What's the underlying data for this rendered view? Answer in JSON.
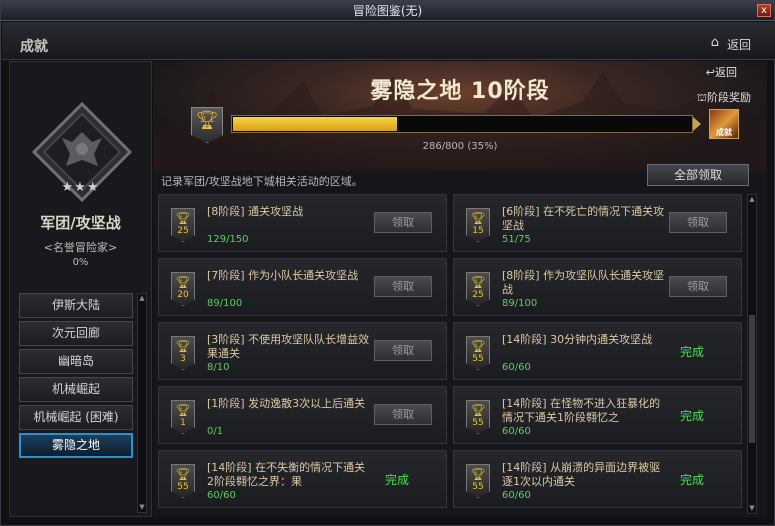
{
  "window": {
    "title": "冒险图鉴(无)",
    "close": "x"
  },
  "header": {
    "section": "成就",
    "home_icon": "home-icon",
    "back": "返回"
  },
  "left": {
    "emblem_icon": "guild-emblem-icon",
    "stars": "★★★",
    "title": "军团/攻坚战",
    "subtitle": "<名誉冒险家>",
    "percent": "0%",
    "nav": [
      {
        "label": "伊斯大陆"
      },
      {
        "label": "次元回廊"
      },
      {
        "label": "幽暗岛"
      },
      {
        "label": "机械崛起"
      },
      {
        "label": "机械崛起 (困难)"
      },
      {
        "label": "雾隐之地",
        "active": true
      }
    ]
  },
  "main": {
    "title": "雾隐之地  10阶段",
    "back": "返回",
    "stage_reward": "阶段奖励",
    "reward_icon_text": "成就",
    "progress": {
      "current": 286,
      "total": 800,
      "fraction": 0.3575,
      "text": "286/800 (35%)"
    },
    "description": "记录军团/攻坚战地下城相关活动的区域。",
    "claim_all": "全部领取",
    "cards": [
      {
        "trophy": "25",
        "title": "[8阶段] 通关攻坚战",
        "progress": "129/150",
        "action": "领取",
        "done": false
      },
      {
        "trophy": "15",
        "title": "[6阶段] 在不死亡的情况下通关攻坚战",
        "progress": "51/75",
        "action": "领取",
        "done": false
      },
      {
        "trophy": "20",
        "title": "[7阶段] 作为小队长通关攻坚战",
        "progress": "89/100",
        "action": "领取",
        "done": false
      },
      {
        "trophy": "25",
        "title": "[8阶段] 作为攻坚队队长通关攻坚战",
        "progress": "89/100",
        "action": "领取",
        "done": false
      },
      {
        "trophy": "3",
        "title": "[3阶段] 不使用攻坚队队长增益效果通关",
        "progress": "8/10",
        "action": "领取",
        "done": false
      },
      {
        "trophy": "55",
        "title": "[14阶段] 30分钟内通关攻坚战",
        "progress": "60/60",
        "action": "完成",
        "done": true
      },
      {
        "trophy": "1",
        "title": "[1阶段] 发动逸散3次以上后通关",
        "progress": "0/1",
        "action": "领取",
        "done": false
      },
      {
        "trophy": "55",
        "title": "[14阶段] 在怪物不进入狂暴化的情况下通关1阶段翱忆之",
        "progress": "60/60",
        "action": "完成",
        "done": true
      },
      {
        "trophy": "55",
        "title": "[14阶段] 在不失衡的情况下通关2阶段翱忆之界：果",
        "progress": "60/60",
        "action": "完成",
        "done": true
      },
      {
        "trophy": "55",
        "title": "[14阶段] 从崩溃的异面边界被驱逐1次以内通关",
        "progress": "60/60",
        "action": "完成",
        "done": true
      }
    ]
  }
}
